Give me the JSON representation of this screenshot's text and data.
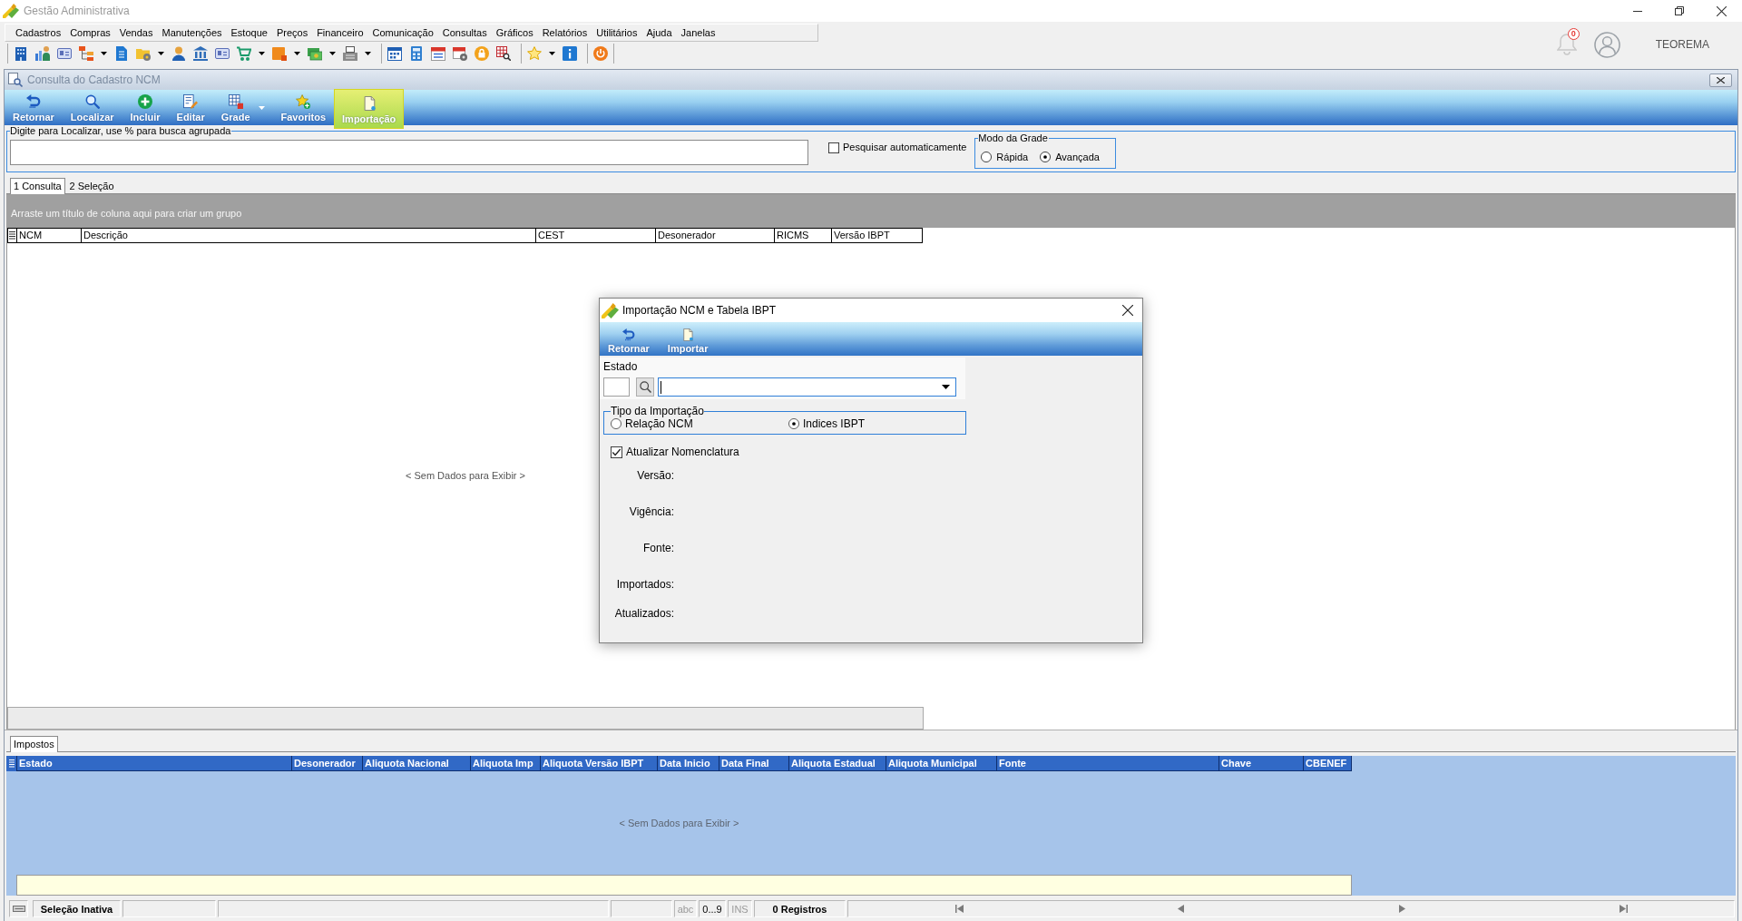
{
  "app_window": {
    "title": "Gestão Administrativa"
  },
  "menu": [
    "Cadastros",
    "Compras",
    "Vendas",
    "Manutenções",
    "Estoque",
    "Preços",
    "Financeiro",
    "Comunicação",
    "Consultas",
    "Gráficos",
    "Relatórios",
    "Utilitários",
    "Ajuda",
    "Janelas"
  ],
  "user_area": {
    "notification_count": "0",
    "user_name": "TEOREMA"
  },
  "child_window": {
    "title": "Consulta do Cadastro NCM",
    "ribbon": [
      {
        "label": "Retornar",
        "selected": false,
        "dropdown": false
      },
      {
        "label": "Localizar",
        "selected": false,
        "dropdown": false
      },
      {
        "label": "Incluir",
        "selected": false,
        "dropdown": false
      },
      {
        "label": "Editar",
        "selected": false,
        "dropdown": false
      },
      {
        "label": "Grade",
        "selected": false,
        "dropdown": true
      },
      {
        "label": "Favoritos",
        "selected": false,
        "dropdown": false
      },
      {
        "label": "Importação",
        "selected": true,
        "dropdown": false
      }
    ]
  },
  "search": {
    "legend": "Digite para Localizar, use % para busca agrupada",
    "auto_search": {
      "label": "Pesquisar automaticamente",
      "checked": false
    },
    "grid_mode": {
      "legend": "Modo da Grade",
      "options": [
        {
          "label": "Rápida",
          "selected": false
        },
        {
          "label": "Avançada",
          "selected": true
        }
      ]
    }
  },
  "tabs": [
    {
      "label": "1 Consulta",
      "selected": true
    },
    {
      "label": "2 Seleção",
      "selected": false
    }
  ],
  "grid": {
    "group_hint": "Arraste um título de coluna aqui para criar um grupo",
    "columns": [
      "NCM",
      "Descrição",
      "CEST",
      "Desonerador",
      "RICMS",
      "Versão IBPT"
    ],
    "empty_text": "< Sem Dados para Exibir >"
  },
  "detail_tabs": [
    {
      "label": "Impostos",
      "selected": true
    }
  ],
  "detail_grid": {
    "columns": [
      "Estado",
      "Desonerador",
      "Aliquota Nacional",
      "Aliquota Imp",
      "Aliquota Versão IBPT",
      "Data Inicio",
      "Data Final",
      "Aliquota Estadual",
      "Aliquota Municipal",
      "Fonte",
      "Chave",
      "CBENEF"
    ],
    "empty_text": "< Sem Dados para Exibir >"
  },
  "status_bar": {
    "selection": "Seleção Inativa",
    "indicators": [
      {
        "label": "abc",
        "on": false
      },
      {
        "label": "0...9",
        "on": true
      },
      {
        "label": "INS",
        "on": false
      }
    ],
    "records": "0 Registros"
  },
  "dialog": {
    "title": "Importação NCM e Tabela IBPT",
    "toolbar": [
      "Retornar",
      "Importar"
    ],
    "state_label": "Estado",
    "import_type": {
      "legend": "Tipo da Importação",
      "options": [
        {
          "label": "Relação NCM",
          "selected": false
        },
        {
          "label": "Indices IBPT",
          "selected": true
        }
      ]
    },
    "update_nomenclature": {
      "label": "Atualizar Nomenclatura",
      "checked": true
    },
    "info_labels": [
      "Versão:",
      "Vigência:",
      "Fonte:",
      "Importados:",
      "Atualizados:"
    ]
  }
}
